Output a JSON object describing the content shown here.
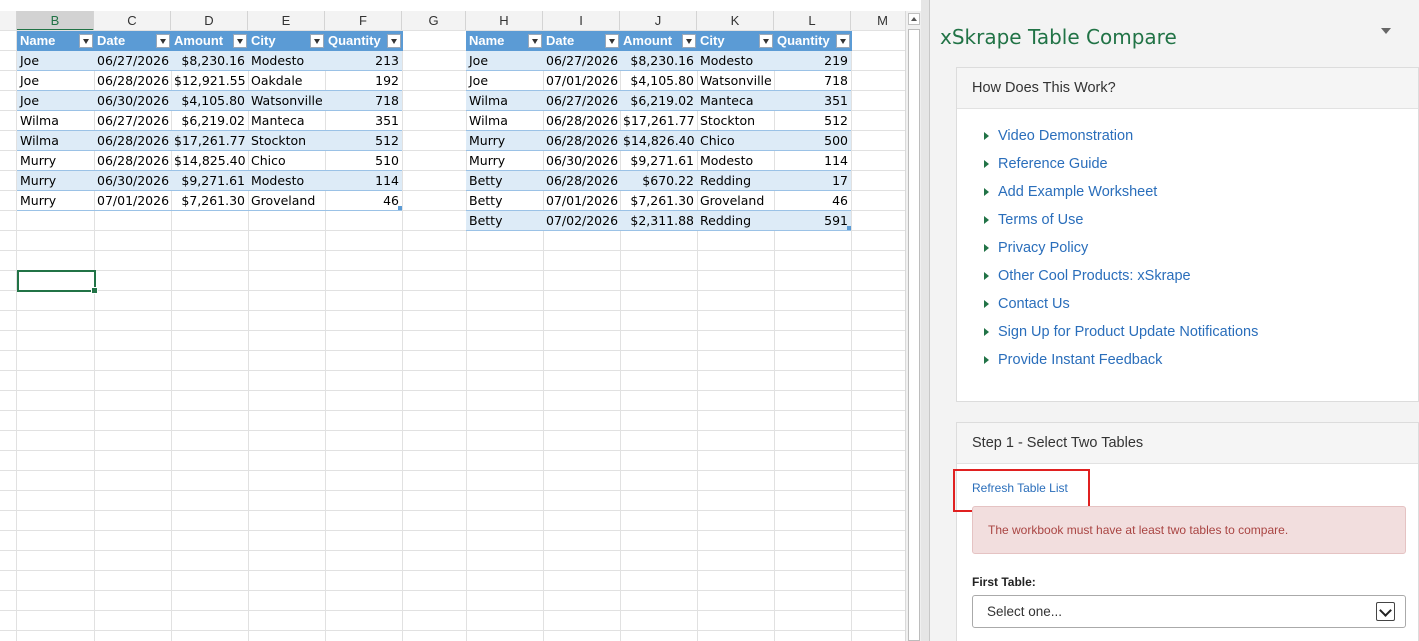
{
  "sheet": {
    "columns": [
      "B",
      "C",
      "D",
      "E",
      "F",
      "G",
      "H",
      "I",
      "J",
      "K",
      "L",
      "M"
    ],
    "selected_column": "B",
    "table1": {
      "headers": [
        "Name",
        "Date",
        "Amount",
        "City",
        "Quantity"
      ],
      "rows": [
        [
          "Joe",
          "06/27/2026",
          "$8,230.16",
          "Modesto",
          "213"
        ],
        [
          "Joe",
          "06/28/2026",
          "$12,921.55",
          "Oakdale",
          "192"
        ],
        [
          "Joe",
          "06/30/2026",
          "$4,105.80",
          "Watsonville",
          "718"
        ],
        [
          "Wilma",
          "06/27/2026",
          "$6,219.02",
          "Manteca",
          "351"
        ],
        [
          "Wilma",
          "06/28/2026",
          "$17,261.77",
          "Stockton",
          "512"
        ],
        [
          "Murry",
          "06/28/2026",
          "$14,825.40",
          "Chico",
          "510"
        ],
        [
          "Murry",
          "06/30/2026",
          "$9,271.61",
          "Modesto",
          "114"
        ],
        [
          "Murry",
          "07/01/2026",
          "$7,261.30",
          "Groveland",
          "46"
        ]
      ]
    },
    "table2": {
      "headers": [
        "Name",
        "Date",
        "Amount",
        "City",
        "Quantity"
      ],
      "rows": [
        [
          "Joe",
          "06/27/2026",
          "$8,230.16",
          "Modesto",
          "219"
        ],
        [
          "Joe",
          "07/01/2026",
          "$4,105.80",
          "Watsonville",
          "718"
        ],
        [
          "Wilma",
          "06/27/2026",
          "$6,219.02",
          "Manteca",
          "351"
        ],
        [
          "Wilma",
          "06/28/2026",
          "$17,261.77",
          "Stockton",
          "512"
        ],
        [
          "Murry",
          "06/28/2026",
          "$14,826.40",
          "Chico",
          "500"
        ],
        [
          "Murry",
          "06/30/2026",
          "$9,271.61",
          "Modesto",
          "114"
        ],
        [
          "Betty",
          "06/28/2026",
          "$670.22",
          "Redding",
          "17"
        ],
        [
          "Betty",
          "07/01/2026",
          "$7,261.30",
          "Groveland",
          "46"
        ],
        [
          "Betty",
          "07/02/2026",
          "$2,311.88",
          "Redding",
          "591"
        ]
      ]
    }
  },
  "pane": {
    "title": "xSkrape Table Compare",
    "how": {
      "heading": "How Does This Work?",
      "links": [
        "Video Demonstration",
        "Reference Guide",
        "Add Example Worksheet",
        "Terms of Use",
        "Privacy Policy",
        "Other Cool Products: xSkrape",
        "Contact Us",
        "Sign Up for Product Update Notifications",
        "Provide Instant Feedback"
      ]
    },
    "step1": {
      "heading": "Step 1 - Select Two Tables",
      "refresh_label": "Refresh Table List",
      "alert": "The workbook must have at least two tables to compare.",
      "first_table_label": "First Table:",
      "first_table_value": "Select one..."
    }
  },
  "colors": {
    "table_header": "#5b9bd5",
    "table_band": "#ddebf7",
    "accent": "#217346",
    "link": "#2a6ebb",
    "alert_bg": "#f2dede",
    "highlight_box": "#e02020"
  }
}
